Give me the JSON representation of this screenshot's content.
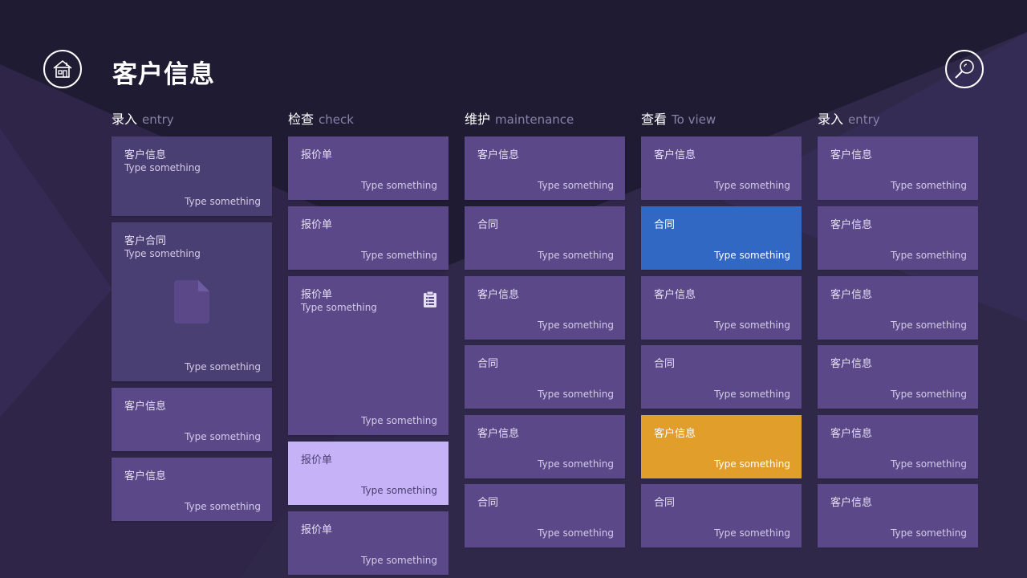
{
  "header": {
    "title": "客户信息",
    "home_icon": "home-icon",
    "search_icon": "search-icon"
  },
  "columns": [
    {
      "cn": "录入",
      "en": "entry"
    },
    {
      "cn": "检查",
      "en": "check"
    },
    {
      "cn": "维护",
      "en": "maintenance"
    },
    {
      "cn": "查看",
      "en": "To view"
    },
    {
      "cn": "录入",
      "en": "entry"
    }
  ],
  "col1": {
    "c1": {
      "title": "客户信息",
      "sub": "Type something",
      "foot": "Type something"
    },
    "c2": {
      "title": "客户合同",
      "sub": "Type something",
      "foot": "Type something",
      "icon": "document-icon"
    },
    "c3": {
      "title": "客户信息",
      "foot": "Type something"
    },
    "c4": {
      "title": "客户信息",
      "foot": "Type something"
    }
  },
  "col2": {
    "c1": {
      "title": "报价单",
      "foot": "Type something"
    },
    "c2": {
      "title": "报价单",
      "foot": "Type something"
    },
    "c3": {
      "title": "报价单",
      "sub": "Type something",
      "foot": "Type something",
      "icon": "clipboard-list-icon"
    },
    "c4": {
      "title": "报价单",
      "foot": "Type something"
    },
    "c5": {
      "title": "报价单",
      "foot": "Type something"
    }
  },
  "col3": {
    "c1": {
      "title": "客户信息",
      "foot": "Type something"
    },
    "c2": {
      "title": "合同",
      "foot": "Type something"
    },
    "c3": {
      "title": "客户信息",
      "foot": "Type something"
    },
    "c4": {
      "title": "合同",
      "foot": "Type something"
    },
    "c5": {
      "title": "客户信息",
      "foot": "Type something"
    },
    "c6": {
      "title": "合同",
      "foot": "Type something"
    }
  },
  "col4": {
    "c1": {
      "title": "客户信息",
      "foot": "Type something"
    },
    "c2": {
      "title": "合同",
      "foot": "Type something"
    },
    "c3": {
      "title": "客户信息",
      "foot": "Type something"
    },
    "c4": {
      "title": "合同",
      "foot": "Type something"
    },
    "c5": {
      "title": "客户信息",
      "foot": "Type something"
    },
    "c6": {
      "title": "合同",
      "foot": "Type something"
    }
  },
  "col5": {
    "c1": {
      "title": "客户信息",
      "foot": "Type something"
    },
    "c2": {
      "title": "客户信息",
      "foot": "Type something"
    },
    "c3": {
      "title": "客户信息",
      "foot": "Type something"
    },
    "c4": {
      "title": "客户信息",
      "foot": "Type something"
    },
    "c5": {
      "title": "客户信息",
      "foot": "Type something"
    },
    "c6": {
      "title": "客户信息",
      "foot": "Type something"
    }
  },
  "colors": {
    "card": "#5a4889",
    "card_dark": "#4a3f72",
    "highlight_blue": "#3168c4",
    "highlight_orange": "#e29e2b",
    "highlight_lilac": "#c6b2f6",
    "background": "#27213f"
  }
}
